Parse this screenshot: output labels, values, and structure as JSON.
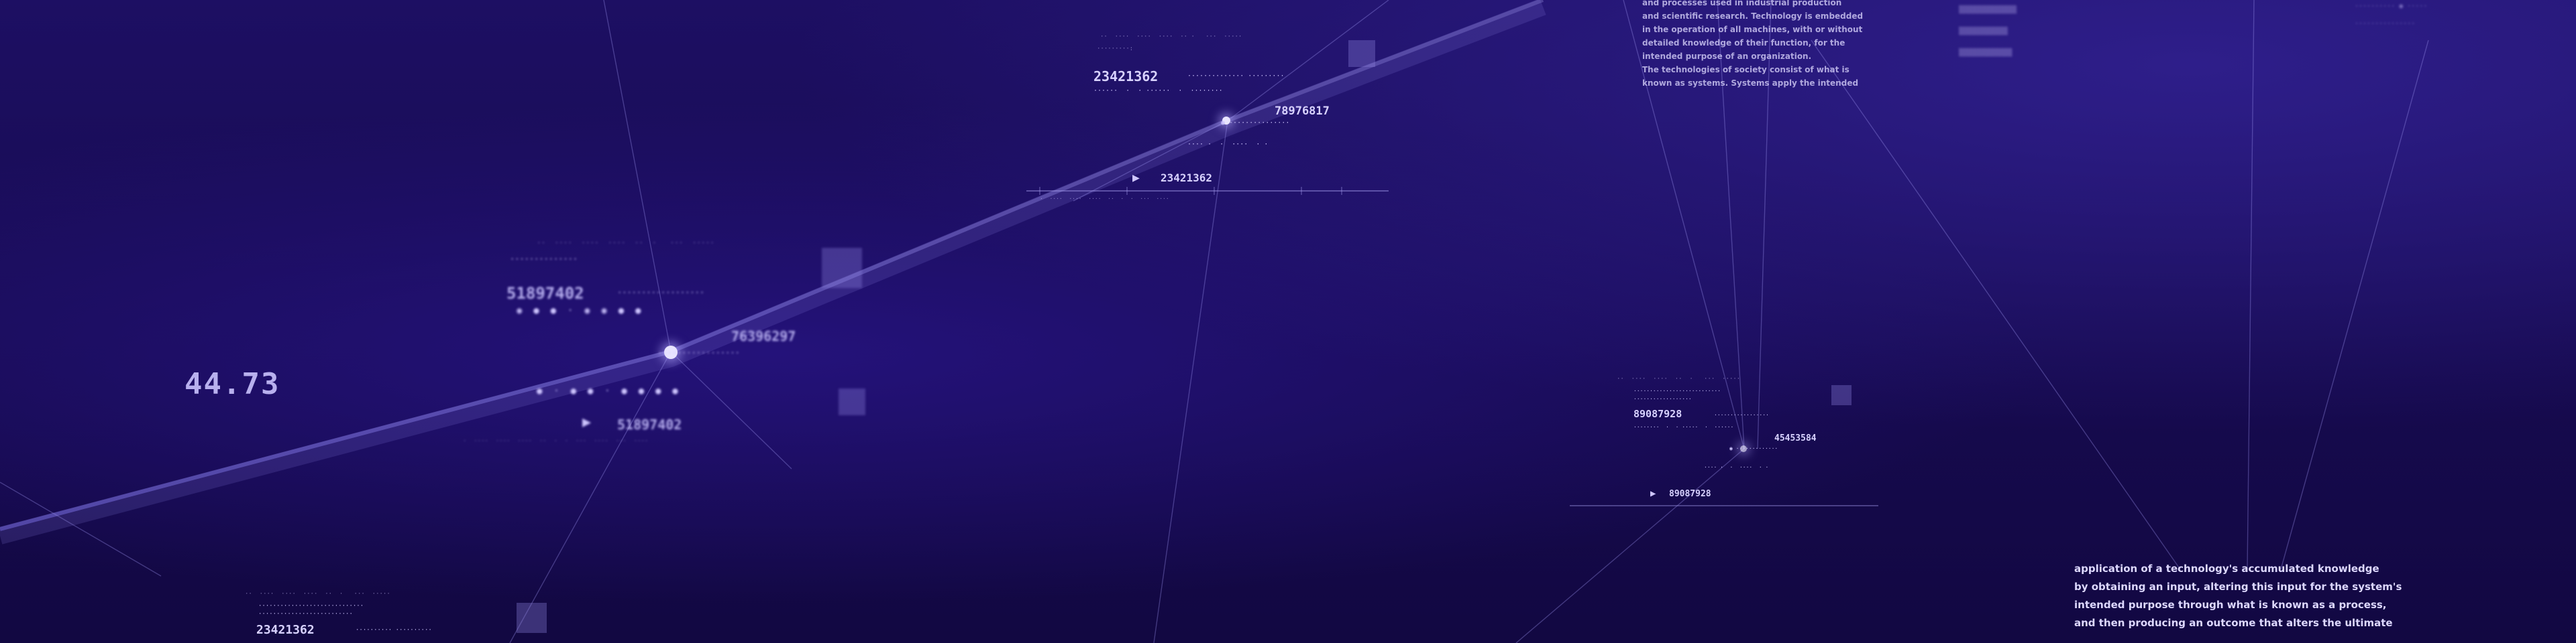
{
  "readout": "44.73",
  "panels": [
    {
      "id": "top-center",
      "numbers": [
        "23421362",
        "78976817",
        "23421362"
      ]
    },
    {
      "id": "left-mid",
      "numbers": [
        "51897402",
        "76396297",
        "51897402"
      ]
    },
    {
      "id": "right-mid",
      "numbers": [
        "89087928",
        "45453584",
        "89087928"
      ]
    },
    {
      "id": "bottom-left",
      "numbers": [
        "23421362"
      ]
    }
  ],
  "paragraph_top": [
    "and processes used in industrial production",
    "and scientific research. Technology is embedded",
    "in the operation of all machines, with or without",
    "detailed knowledge of their function, for the",
    "intended purpose of an organization.",
    "The technologies of society consist of what is",
    "known as systems. Systems apply the intended"
  ],
  "paragraph_bottom": [
    "application of a technology's accumulated knowledge",
    "by obtaining an input, altering this input for the system's",
    "intended purpose through what is known as a process,",
    "and then producing an outcome that alters the ultimate"
  ],
  "colors": {
    "background": "#170a52",
    "accent": "#cfc6ff",
    "glow": "#e8e4ff"
  }
}
